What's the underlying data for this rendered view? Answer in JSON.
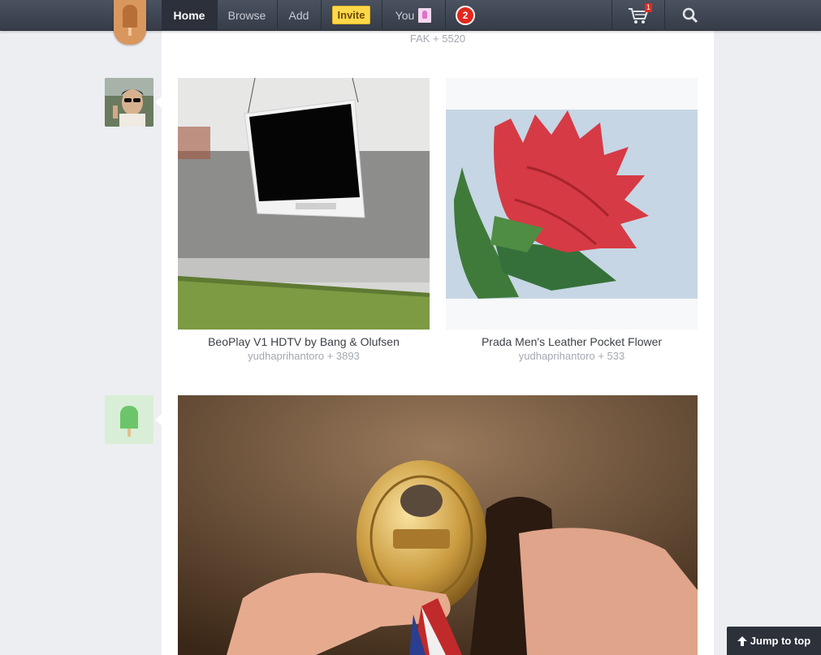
{
  "nav": {
    "home": "Home",
    "browse": "Browse",
    "add": "Add",
    "invite": "Invite",
    "you": "You",
    "notifications": "2",
    "cart_count": "1"
  },
  "feed": {
    "top_credit": "FAK + 5520",
    "items": [
      {
        "title": "BeoPlay V1 HDTV by Bang & Olufsen",
        "credit": "yudhaprihantoro + 3893"
      },
      {
        "title": "Prada Men's Leather Pocket Flower",
        "credit": "yudhaprihantoro + 533"
      }
    ]
  },
  "jump": {
    "label": "Jump to top"
  },
  "icons": [
    "popsicle-logo-icon",
    "cart-icon",
    "search-icon",
    "arrow-up-icon"
  ],
  "colors": {
    "topbar": "#3d4451",
    "invite": "#ffd84a",
    "badge": "#e3281d",
    "page_bg": "#eceef2"
  }
}
